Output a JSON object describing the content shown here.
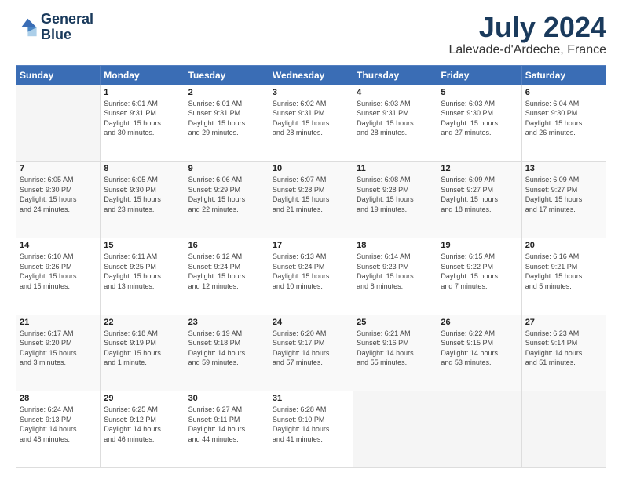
{
  "logo": {
    "text_line1": "General",
    "text_line2": "Blue"
  },
  "header": {
    "month": "July 2024",
    "location": "Lalevade-d'Ardeche, France"
  },
  "weekdays": [
    "Sunday",
    "Monday",
    "Tuesday",
    "Wednesday",
    "Thursday",
    "Friday",
    "Saturday"
  ],
  "weeks": [
    [
      {
        "day": "",
        "empty": true
      },
      {
        "day": "1",
        "sunrise": "6:01 AM",
        "sunset": "9:31 PM",
        "daylight": "15 hours and 30 minutes."
      },
      {
        "day": "2",
        "sunrise": "6:01 AM",
        "sunset": "9:31 PM",
        "daylight": "15 hours and 29 minutes."
      },
      {
        "day": "3",
        "sunrise": "6:02 AM",
        "sunset": "9:31 PM",
        "daylight": "15 hours and 28 minutes."
      },
      {
        "day": "4",
        "sunrise": "6:03 AM",
        "sunset": "9:31 PM",
        "daylight": "15 hours and 28 minutes."
      },
      {
        "day": "5",
        "sunrise": "6:03 AM",
        "sunset": "9:30 PM",
        "daylight": "15 hours and 27 minutes."
      },
      {
        "day": "6",
        "sunrise": "6:04 AM",
        "sunset": "9:30 PM",
        "daylight": "15 hours and 26 minutes."
      }
    ],
    [
      {
        "day": "7",
        "sunrise": "6:05 AM",
        "sunset": "9:30 PM",
        "daylight": "15 hours and 24 minutes."
      },
      {
        "day": "8",
        "sunrise": "6:05 AM",
        "sunset": "9:30 PM",
        "daylight": "15 hours and 23 minutes."
      },
      {
        "day": "9",
        "sunrise": "6:06 AM",
        "sunset": "9:29 PM",
        "daylight": "15 hours and 22 minutes."
      },
      {
        "day": "10",
        "sunrise": "6:07 AM",
        "sunset": "9:28 PM",
        "daylight": "15 hours and 21 minutes."
      },
      {
        "day": "11",
        "sunrise": "6:08 AM",
        "sunset": "9:28 PM",
        "daylight": "15 hours and 19 minutes."
      },
      {
        "day": "12",
        "sunrise": "6:09 AM",
        "sunset": "9:27 PM",
        "daylight": "15 hours and 18 minutes."
      },
      {
        "day": "13",
        "sunrise": "6:09 AM",
        "sunset": "9:27 PM",
        "daylight": "15 hours and 17 minutes."
      }
    ],
    [
      {
        "day": "14",
        "sunrise": "6:10 AM",
        "sunset": "9:26 PM",
        "daylight": "15 hours and 15 minutes."
      },
      {
        "day": "15",
        "sunrise": "6:11 AM",
        "sunset": "9:25 PM",
        "daylight": "15 hours and 13 minutes."
      },
      {
        "day": "16",
        "sunrise": "6:12 AM",
        "sunset": "9:24 PM",
        "daylight": "15 hours and 12 minutes."
      },
      {
        "day": "17",
        "sunrise": "6:13 AM",
        "sunset": "9:24 PM",
        "daylight": "15 hours and 10 minutes."
      },
      {
        "day": "18",
        "sunrise": "6:14 AM",
        "sunset": "9:23 PM",
        "daylight": "15 hours and 8 minutes."
      },
      {
        "day": "19",
        "sunrise": "6:15 AM",
        "sunset": "9:22 PM",
        "daylight": "15 hours and 7 minutes."
      },
      {
        "day": "20",
        "sunrise": "6:16 AM",
        "sunset": "9:21 PM",
        "daylight": "15 hours and 5 minutes."
      }
    ],
    [
      {
        "day": "21",
        "sunrise": "6:17 AM",
        "sunset": "9:20 PM",
        "daylight": "15 hours and 3 minutes."
      },
      {
        "day": "22",
        "sunrise": "6:18 AM",
        "sunset": "9:19 PM",
        "daylight": "15 hours and 1 minute."
      },
      {
        "day": "23",
        "sunrise": "6:19 AM",
        "sunset": "9:18 PM",
        "daylight": "14 hours and 59 minutes."
      },
      {
        "day": "24",
        "sunrise": "6:20 AM",
        "sunset": "9:17 PM",
        "daylight": "14 hours and 57 minutes."
      },
      {
        "day": "25",
        "sunrise": "6:21 AM",
        "sunset": "9:16 PM",
        "daylight": "14 hours and 55 minutes."
      },
      {
        "day": "26",
        "sunrise": "6:22 AM",
        "sunset": "9:15 PM",
        "daylight": "14 hours and 53 minutes."
      },
      {
        "day": "27",
        "sunrise": "6:23 AM",
        "sunset": "9:14 PM",
        "daylight": "14 hours and 51 minutes."
      }
    ],
    [
      {
        "day": "28",
        "sunrise": "6:24 AM",
        "sunset": "9:13 PM",
        "daylight": "14 hours and 48 minutes."
      },
      {
        "day": "29",
        "sunrise": "6:25 AM",
        "sunset": "9:12 PM",
        "daylight": "14 hours and 46 minutes."
      },
      {
        "day": "30",
        "sunrise": "6:27 AM",
        "sunset": "9:11 PM",
        "daylight": "14 hours and 44 minutes."
      },
      {
        "day": "31",
        "sunrise": "6:28 AM",
        "sunset": "9:10 PM",
        "daylight": "14 hours and 41 minutes."
      },
      {
        "day": "",
        "empty": true
      },
      {
        "day": "",
        "empty": true
      },
      {
        "day": "",
        "empty": true
      }
    ]
  ]
}
